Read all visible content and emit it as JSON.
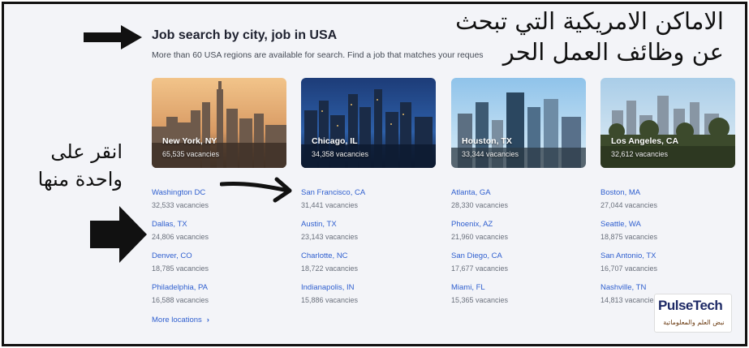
{
  "header": {
    "title": "Job search by city, job in USA",
    "subtitle": "More than 60 USA regions are available for search. Find a job that matches your reques"
  },
  "cards": [
    {
      "city": "New York, NY",
      "vacancies": "65,535 vacancies"
    },
    {
      "city": "Chicago, IL",
      "vacancies": "34,358 vacancies"
    },
    {
      "city": "Houston, TX",
      "vacancies": "33,344 vacancies"
    },
    {
      "city": "Los Angeles, CA",
      "vacancies": "32,612 vacancies"
    }
  ],
  "locations": [
    {
      "name": "Washington DC",
      "vacancies": "32,533 vacancies"
    },
    {
      "name": "San Francisco, CA",
      "vacancies": "31,441 vacancies"
    },
    {
      "name": "Atlanta, GA",
      "vacancies": "28,330 vacancies"
    },
    {
      "name": "Boston, MA",
      "vacancies": "27,044 vacancies"
    },
    {
      "name": "Dallas, TX",
      "vacancies": "24,806 vacancies"
    },
    {
      "name": "Austin, TX",
      "vacancies": "23,143 vacancies"
    },
    {
      "name": "Phoenix, AZ",
      "vacancies": "21,960 vacancies"
    },
    {
      "name": "Seattle, WA",
      "vacancies": "18,875 vacancies"
    },
    {
      "name": "Denver, CO",
      "vacancies": "18,785 vacancies"
    },
    {
      "name": "Charlotte, NC",
      "vacancies": "18,722 vacancies"
    },
    {
      "name": "San Diego, CA",
      "vacancies": "17,677 vacancies"
    },
    {
      "name": "San Antonio, TX",
      "vacancies": "16,707 vacancies"
    },
    {
      "name": "Philadelphia, PA",
      "vacancies": "16,588 vacancies"
    },
    {
      "name": "Indianapolis, IN",
      "vacancies": "15,886 vacancies"
    },
    {
      "name": "Miami, FL",
      "vacancies": "15,365 vacancies"
    },
    {
      "name": "Nashville, TN",
      "vacancies": "14,813 vacancies"
    }
  ],
  "more_locations": "More locations",
  "annotations": {
    "top_line1": "الاماكن الامريكية التي تبحث",
    "top_line2": "عن وظائف العمل الحر",
    "left_line1": "انقر على",
    "left_line2": "واحدة منها"
  },
  "logo": {
    "main": "PulseTech",
    "sub": "نبض العلم والمعلوماتية"
  },
  "colors": {
    "link": "#2f5fcf",
    "background": "#f3f4f8"
  },
  "icons": {
    "more_chevron": "chevron-right-icon"
  }
}
